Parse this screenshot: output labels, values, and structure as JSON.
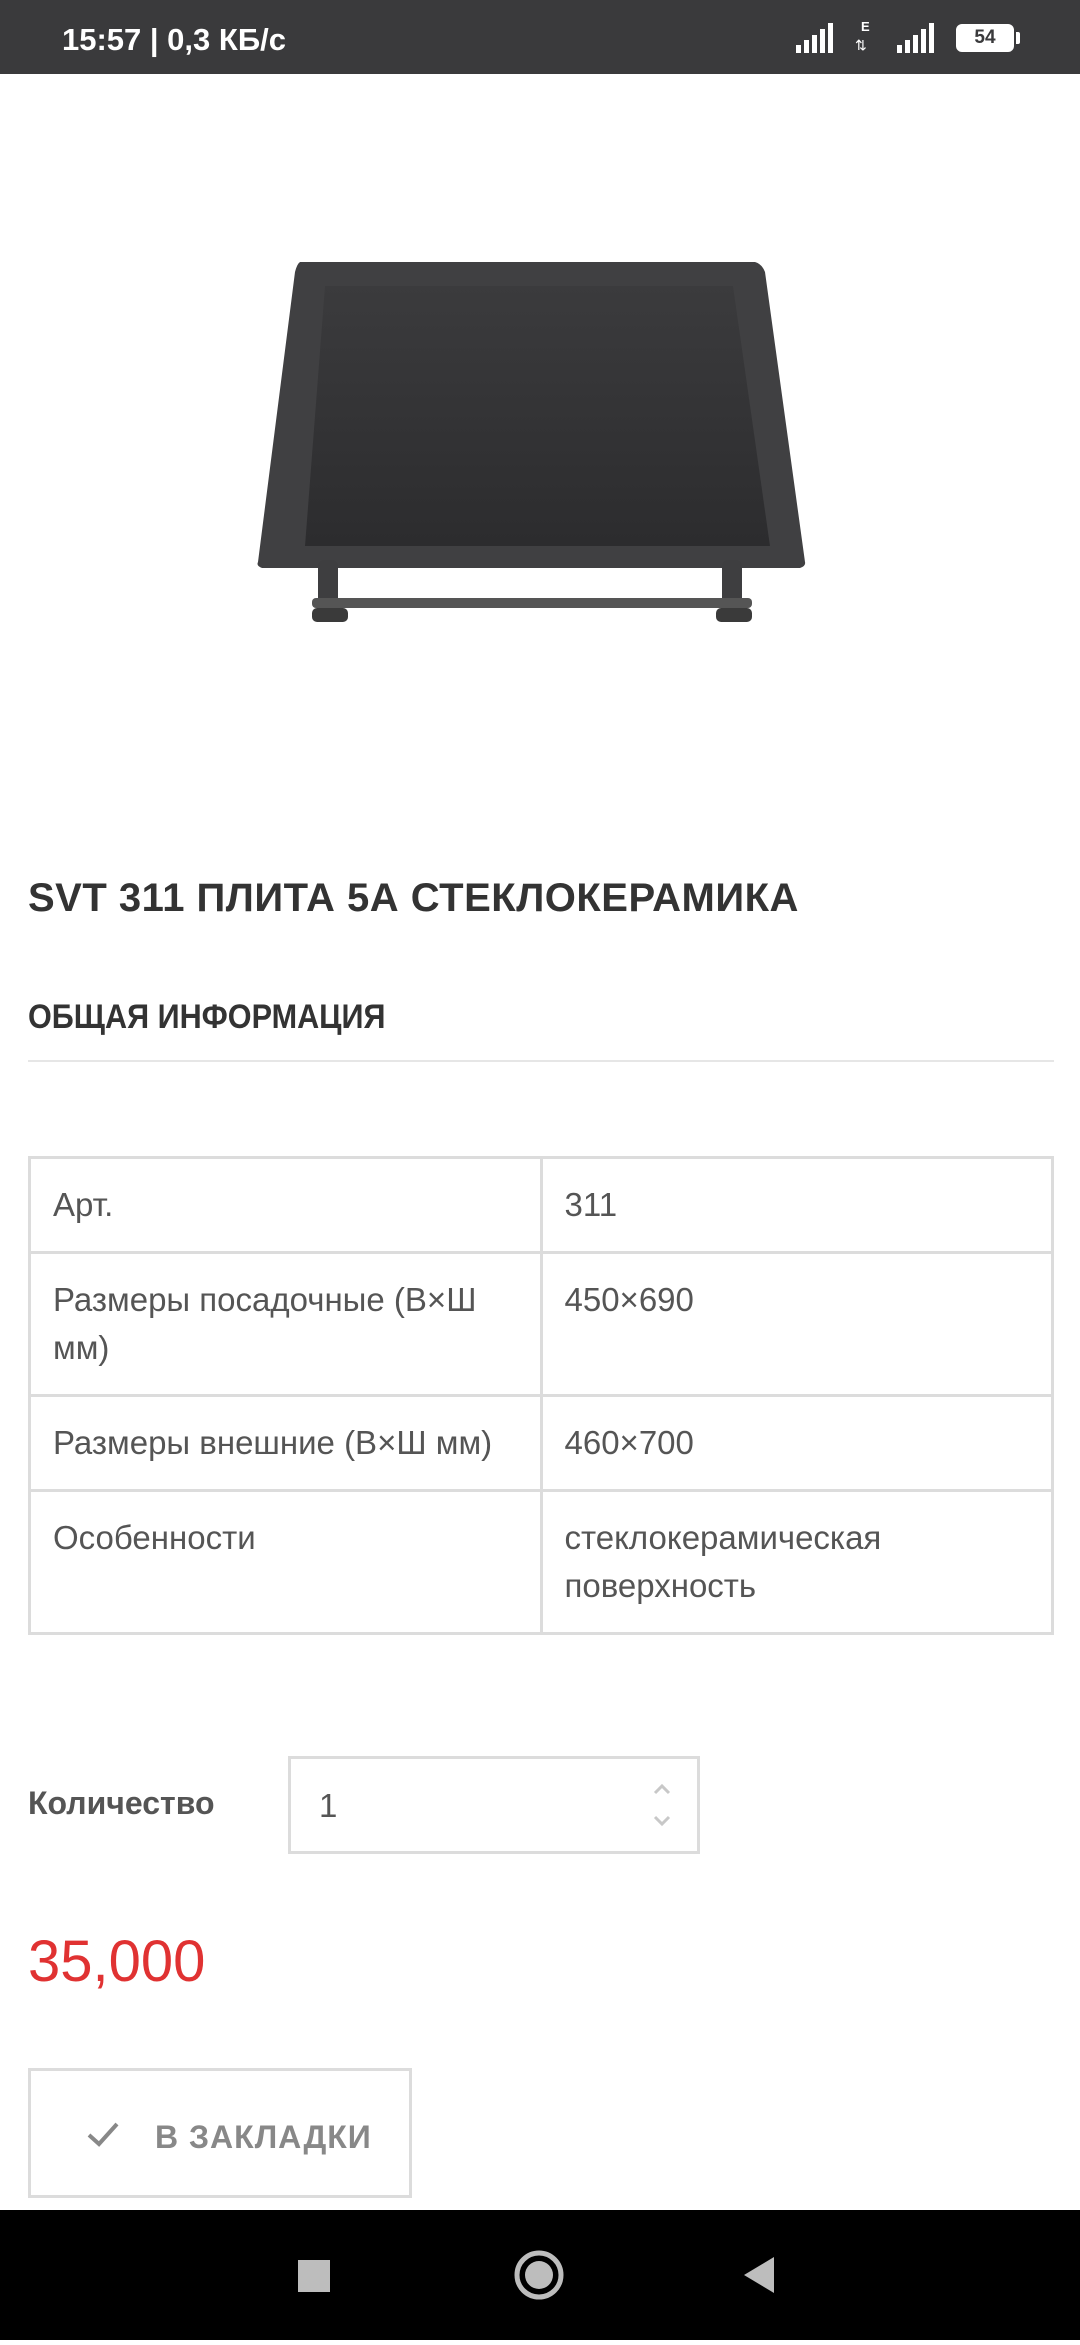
{
  "status_bar": {
    "time": "15:57 | 0,3 КБ/с",
    "battery": "54",
    "network_type": "E"
  },
  "product": {
    "image_icon": "glass-ceramic-hob-image",
    "title": "SVT 311 ПЛИТА 5А СТЕКЛОКЕРАМИКА"
  },
  "section": {
    "title": "ОБЩАЯ ИНФОРМАЦИЯ"
  },
  "specs": [
    {
      "label": "Арт.",
      "value": "311"
    },
    {
      "label": "Размеры посадочные (В×Ш мм)",
      "value": "450×690"
    },
    {
      "label": "Размеры внешние (В×Ш мм)",
      "value": "460×700"
    },
    {
      "label": "Особенности",
      "value": "стеклокерамическая поверхность"
    }
  ],
  "quantity": {
    "label": "Количество",
    "value": "1"
  },
  "price": "35,000",
  "bookmark": {
    "label": "В ЗАКЛАДКИ",
    "icon": "checkmark-icon"
  },
  "colors": {
    "price": "#e03232",
    "status_bar": "#3a3a3c",
    "border": "#dcdcdc"
  }
}
